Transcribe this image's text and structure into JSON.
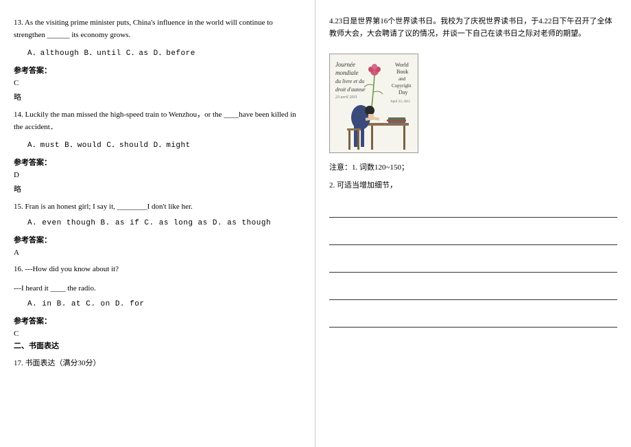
{
  "q13": {
    "text": "13. As the visiting prime minister puts, China's influence in the world will continue to strengthen ______ its economy grows.",
    "options": "A．although        B．until            C．as              D．before",
    "answer_label": "参考答案：",
    "answer": "C",
    "extra": "略"
  },
  "q14": {
    "text": "14. Luckily the man missed the high-speed train to Wenzhou，or the ____have been killed in the accident．",
    "options": "A．must          B．would           C．should          D．might",
    "answer_label": "参考答案：",
    "answer": "D",
    "extra": "略"
  },
  "q15": {
    "text": "15. Fran is an honest girl; I say it, ________I don't like her.",
    "options": "A. even though   B. as if    C. as long as    D. as though",
    "answer_label": "参考答案：",
    "answer": "A"
  },
  "q16": {
    "text1": "16. ---How did you know about it?",
    "text2": "---I heard it ____ the radio.",
    "options": "A. in              B. at                 C. on           D. for",
    "answer_label": "参考答案：",
    "answer": "C"
  },
  "section2": {
    "header": "二、书面表达",
    "item": "17. 书面表达（满分30分）"
  },
  "rightcol": {
    "prompt": "4.23日是世界第16个世界读书日。我校为了庆祝世界读书日，于4.22日下午召开了全体教师大会，大会聘请了议的情况，并谈一下自己在读书日之际对老师的期望。",
    "notes_label": "注意：1. 词数120~150；",
    "notes_item2": "2. 可适当增加细节，",
    "image_left_top": "Journée",
    "image_left_2": "mondiale",
    "image_left_3": "du livre et du",
    "image_left_4": "droit d'auteur",
    "image_left_5": "23 avril 2011",
    "image_right_top": "World",
    "image_right_2": "Book",
    "image_right_3": "and",
    "image_right_4": "Copyright",
    "image_right_5": "Day",
    "image_right_6": "April 23, 2011"
  }
}
